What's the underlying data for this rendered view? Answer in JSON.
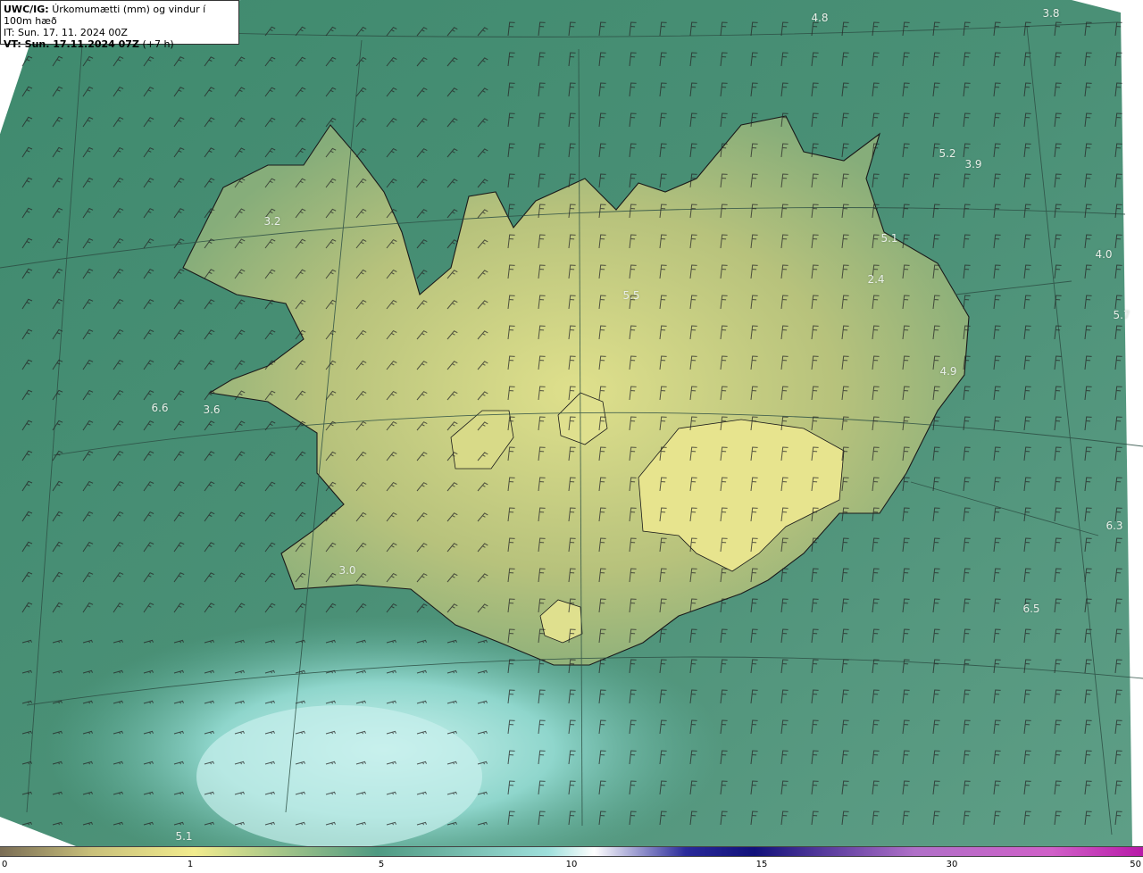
{
  "header": {
    "title_prefix": "UWC/IG:",
    "title_text": "Úrkomumætti (mm) og vindur í 100m hæð",
    "it_line": "IT: Sun. 17. 11. 2024 00Z",
    "vt_prefix": "VT: Sun. 17.11.2024 07Z",
    "vt_suffix": "(+7 h)"
  },
  "map_labels": [
    {
      "text": "4.8"
    },
    {
      "text": "3.8"
    },
    {
      "text": "5.2"
    },
    {
      "text": "3.9"
    },
    {
      "text": "3.2"
    },
    {
      "text": "5.1"
    },
    {
      "text": "4.0"
    },
    {
      "text": "2.4"
    },
    {
      "text": "5.5"
    },
    {
      "text": "5.7"
    },
    {
      "text": "4.9"
    },
    {
      "text": "6.6"
    },
    {
      "text": "3.6"
    },
    {
      "text": "6.3"
    },
    {
      "text": "3.0"
    },
    {
      "text": "6.5"
    },
    {
      "text": "5.1"
    }
  ],
  "colorbar": {
    "ticks": [
      "0",
      "1",
      "5",
      "10",
      "15",
      "30",
      "50"
    ],
    "colors": [
      "#7a6d55",
      "#c9c07a",
      "#f2ec8e",
      "#4f9a82",
      "#9fe0dc",
      "#ffffff",
      "#2a2a9a",
      "#11117a",
      "#b070c8",
      "#d060c8",
      "#b81aa8"
    ]
  }
}
